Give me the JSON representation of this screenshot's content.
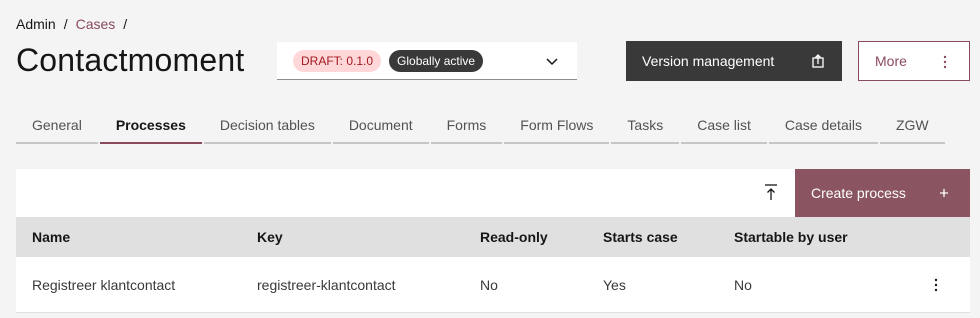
{
  "breadcrumb": {
    "root": "Admin",
    "link": "Cases",
    "sep": "/"
  },
  "page": {
    "title": "Contactmoment"
  },
  "version_select": {
    "draft_tag": "DRAFT: 0.1.0",
    "status_tag": "Globally active"
  },
  "actions": {
    "version_management": "Version management",
    "more": "More"
  },
  "tabs": [
    {
      "label": "General"
    },
    {
      "label": "Processes"
    },
    {
      "label": "Decision tables"
    },
    {
      "label": "Document"
    },
    {
      "label": "Forms"
    },
    {
      "label": "Form Flows"
    },
    {
      "label": "Tasks"
    },
    {
      "label": "Case list"
    },
    {
      "label": "Case details"
    },
    {
      "label": "ZGW"
    }
  ],
  "active_tab": "Processes",
  "toolbar": {
    "create_label": "Create process"
  },
  "table": {
    "headers": [
      "Name",
      "Key",
      "Read-only",
      "Starts case",
      "Startable by user"
    ],
    "rows": [
      [
        "Registreer klantcontact",
        "registreer-klantcontact",
        "No",
        "Yes",
        "No"
      ]
    ]
  },
  "colors": {
    "accent": "#8a4a5c",
    "dark_button": "#393939",
    "create_button": "#8a5560"
  }
}
